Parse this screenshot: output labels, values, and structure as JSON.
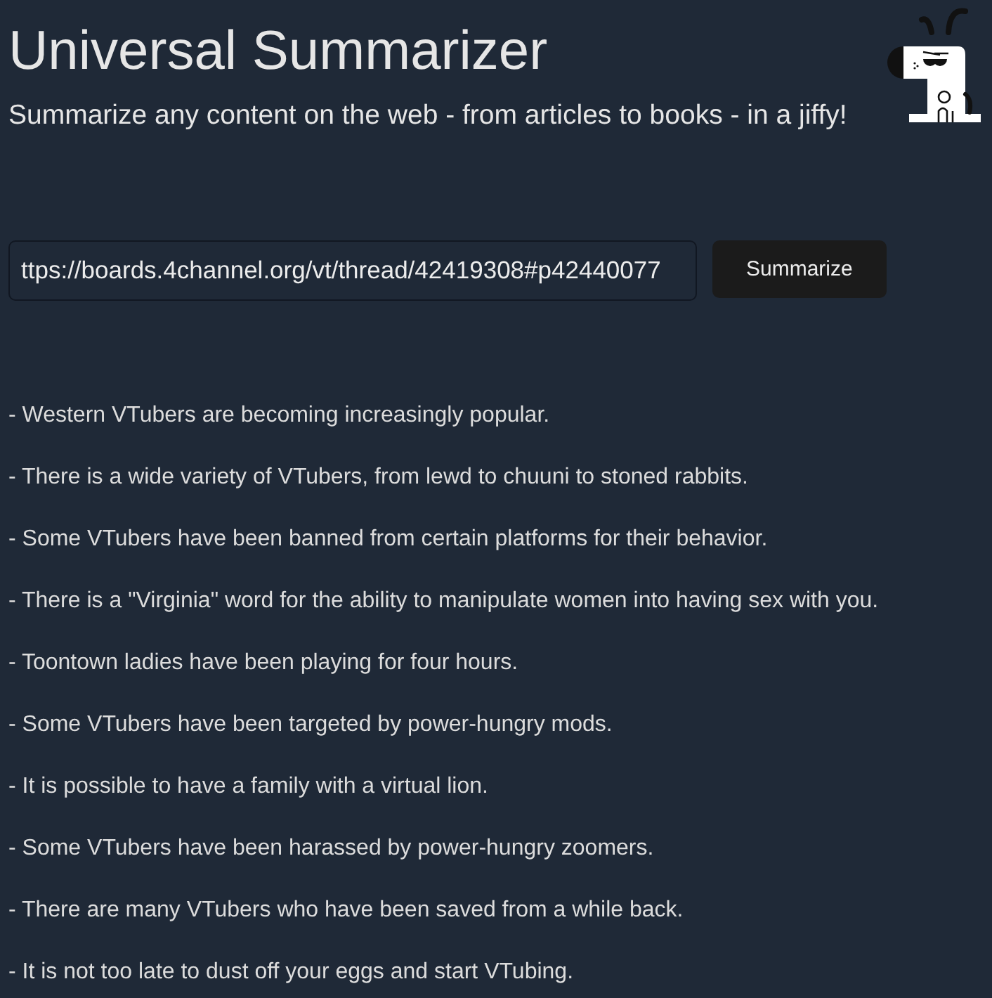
{
  "header": {
    "title": "Universal Summarizer",
    "subtitle": "Summarize any content on the web - from articles to books - in a jiffy!"
  },
  "form": {
    "url_field": {
      "value": "ttps://boards.4channel.org/vt/thread/42419308#p42440077"
    },
    "submit_button": "Summarize"
  },
  "summary": [
    "- Western VTubers are becoming increasingly popular.",
    "- There is a wide variety of VTubers, from lewd to chuuni to stoned rabbits.",
    "- Some VTubers have been banned from certain platforms for their behavior.",
    "- There is a \"Virginia\" word for the ability to manipulate women into having sex with you.",
    "- Toontown ladies have been playing for four hours.",
    "- Some VTubers have been targeted by power-hungry mods.",
    "- It is possible to have a family with a virtual lion.",
    "- Some VTubers have been harassed by power-hungry zoomers.",
    "- There are many VTubers who have been saved from a while back.",
    "- It is not too late to dust off your eggs and start VTubing."
  ]
}
